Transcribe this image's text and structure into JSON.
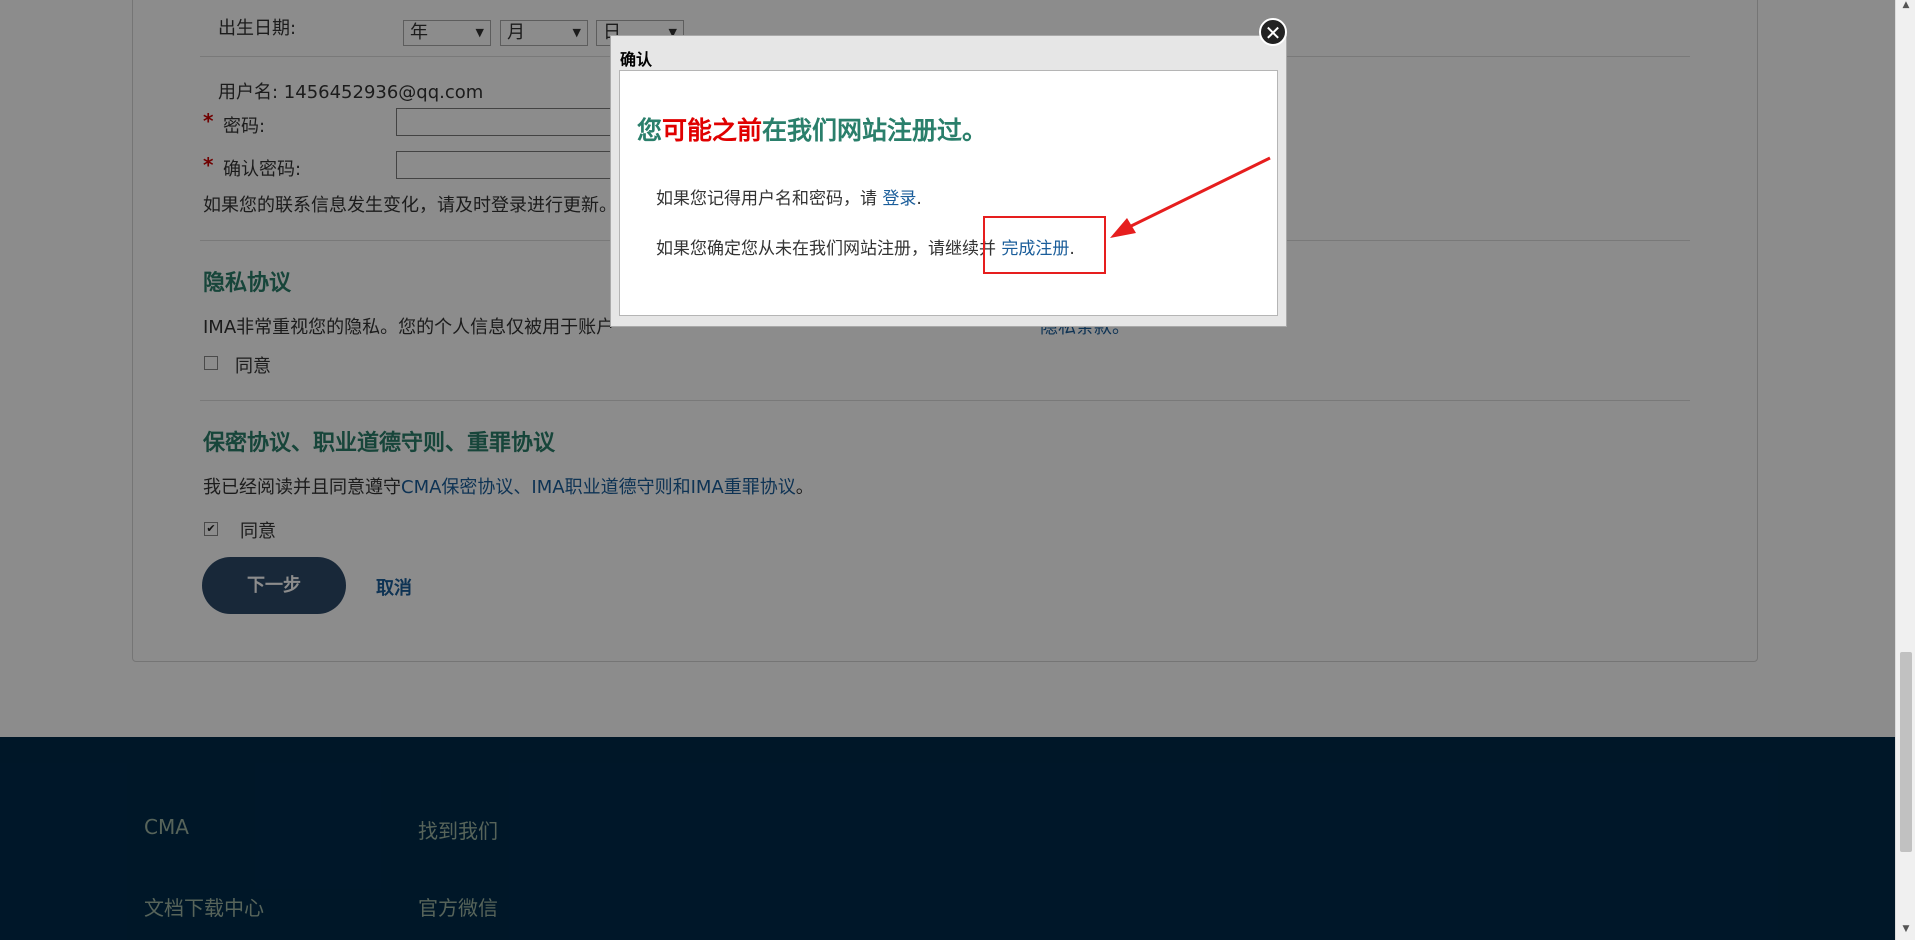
{
  "form": {
    "birth_label": "出生日期:",
    "year_select": "年",
    "month_select": "月",
    "day_select": "日",
    "username_label": "用户名: 1456452936@qq.com",
    "required_mark": "*",
    "password_label": "密码:",
    "confirm_password_label": "确认密码:",
    "update_note": "如果您的联系信息发生变化，请及时登录进行更新。"
  },
  "privacy": {
    "title": "隐私协议",
    "text_start": "IMA非常重视您的隐私。您的个人信息仅被用于账户",
    "text_end": "隐私条款。",
    "agree_label": "同意",
    "checked": false
  },
  "agreements": {
    "title": "保密协议、职业道德守则、重罪协议",
    "text_prefix": "我已经阅读并且同意遵守",
    "link_text": "CMA保密协议、IMA职业道德守则和IMA重罪协议",
    "text_suffix": "。",
    "agree_label": "同意",
    "checked": true,
    "check_glyph": "✔"
  },
  "actions": {
    "next_label": "下一步",
    "cancel_label": "取消"
  },
  "footer": {
    "col1": [
      "CMA",
      "文档下载中心"
    ],
    "col2": [
      "找到我们",
      "官方微信"
    ]
  },
  "modal": {
    "title": "确认",
    "close_glyph": "✕",
    "heading_part1": "您",
    "heading_part2": "可能之前",
    "heading_part3": "在我们网站注册过。",
    "line1_prefix": "如果您记得用户名和密码，请 ",
    "line1_link": "登录",
    "line1_suffix": ".",
    "line2_prefix": "如果您确定您从未在我们网站注册，请继续并 ",
    "line2_link": "完成注册",
    "line2_suffix": "."
  },
  "colors": {
    "accent_green": "#2a7f6b",
    "accent_red": "#e00000",
    "link_blue": "#1a5d9a",
    "footer_bg": "#002a4a",
    "annotation_red": "#e61e1e"
  }
}
